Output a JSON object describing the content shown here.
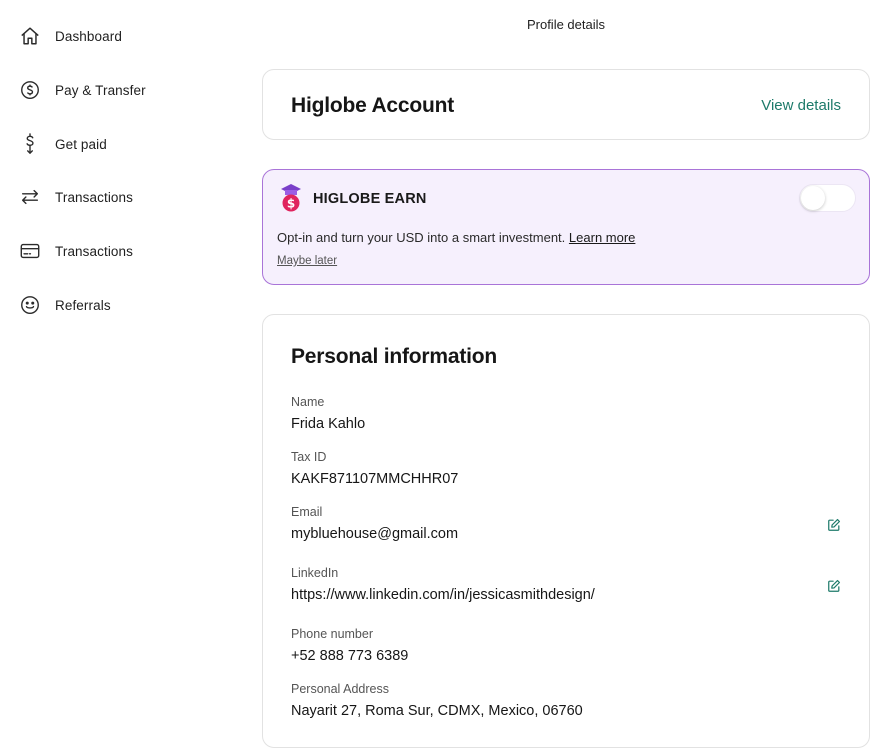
{
  "sidebar": {
    "items": [
      {
        "label": "Dashboard",
        "icon": "home-icon"
      },
      {
        "label": "Pay & Transfer",
        "icon": "dollar-circle-icon"
      },
      {
        "label": "Get paid",
        "icon": "dollar-arrow-down-icon"
      },
      {
        "label": "Transactions",
        "icon": "swap-arrows-icon"
      },
      {
        "label": "Transactions",
        "icon": "card-icon"
      },
      {
        "label": "Referrals",
        "icon": "smiley-icon"
      }
    ]
  },
  "header": {
    "title": "Profile details"
  },
  "account": {
    "title": "Higlobe Account",
    "link": "View details"
  },
  "earn": {
    "title": "HIGLOBE EARN",
    "toggle_on": false,
    "description": "Opt-in and turn your USD into a smart investment.",
    "learn_more": "Learn more",
    "maybe_later": "Maybe later"
  },
  "personal": {
    "title": "Personal information",
    "fields": [
      {
        "label": "Name",
        "value": "Frida Kahlo",
        "editable": false
      },
      {
        "label": "Tax ID",
        "value": "KAKF871107MMCHHR07",
        "editable": false
      },
      {
        "label": "Email",
        "value": "mybluehouse@gmail.com",
        "editable": true
      },
      {
        "label": "LinkedIn",
        "value": "https://www.linkedin.com/in/jessicasmithdesign/",
        "editable": true
      },
      {
        "label": "Phone number",
        "value": "+52 888 773 6389",
        "editable": false
      },
      {
        "label": "Personal Address",
        "value": "Nayarit 27, Roma Sur, CDMX, Mexico, 06760",
        "editable": false
      }
    ]
  },
  "colors": {
    "accent": "#1d7a6a",
    "earn_border": "#a974d8",
    "earn_bg": "#f6f0fd",
    "badge_purple": "#7a3fc9",
    "badge_red": "#e0245e"
  }
}
